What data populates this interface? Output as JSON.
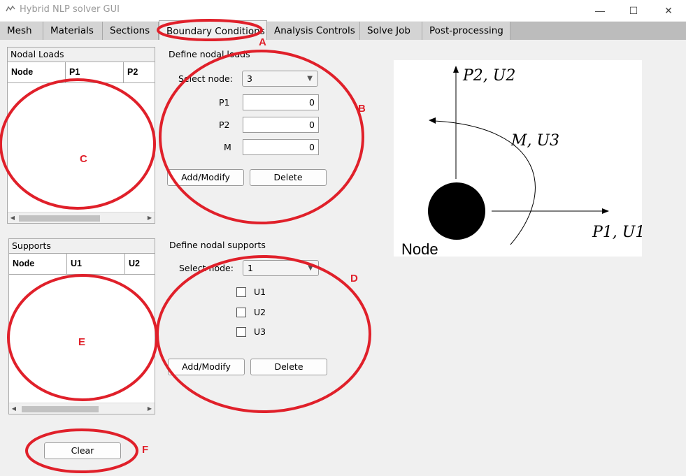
{
  "window": {
    "title": "Hybrid NLP solver GUI",
    "minimize": "—",
    "maximize": "☐",
    "close": "✕"
  },
  "tabs": [
    "Mesh",
    "Materials",
    "Sections",
    "Boundary Conditions",
    "Analysis Controls",
    "Solve Job",
    "Post-processing"
  ],
  "active_tab": "Boundary Conditions",
  "nodal_loads_panel": {
    "title": "Nodal Loads",
    "columns": [
      "Node",
      "P1",
      "P2"
    ],
    "rows": []
  },
  "define_loads": {
    "heading": "Define nodal loads",
    "select_label": "Select node:",
    "select_value": "3",
    "p1_label": "P1",
    "p1_value": "0",
    "p2_label": "P2",
    "p2_value": "0",
    "m_label": "M",
    "m_value": "0",
    "add_button": "Add/Modify",
    "delete_button": "Delete"
  },
  "supports_panel": {
    "title": "Supports",
    "columns": [
      "Node",
      "U1",
      "U2"
    ],
    "rows": []
  },
  "define_supports": {
    "heading": "Define nodal supports",
    "select_label": "Select node:",
    "select_value": "1",
    "u1_label": "U1",
    "u2_label": "U2",
    "u3_label": "U3",
    "u1_checked": false,
    "u2_checked": false,
    "u3_checked": false,
    "add_button": "Add/Modify",
    "delete_button": "Delete"
  },
  "clear_button": "Clear",
  "diagram": {
    "p2_u2": "P2, U2",
    "m_u3": "M, U3",
    "p1_u1": "P1, U1",
    "node_label": "Node"
  },
  "annotations": {
    "a": "A",
    "b": "B",
    "c": "C",
    "d": "D",
    "e": "E",
    "f": "F",
    "color": "#e0202a"
  }
}
